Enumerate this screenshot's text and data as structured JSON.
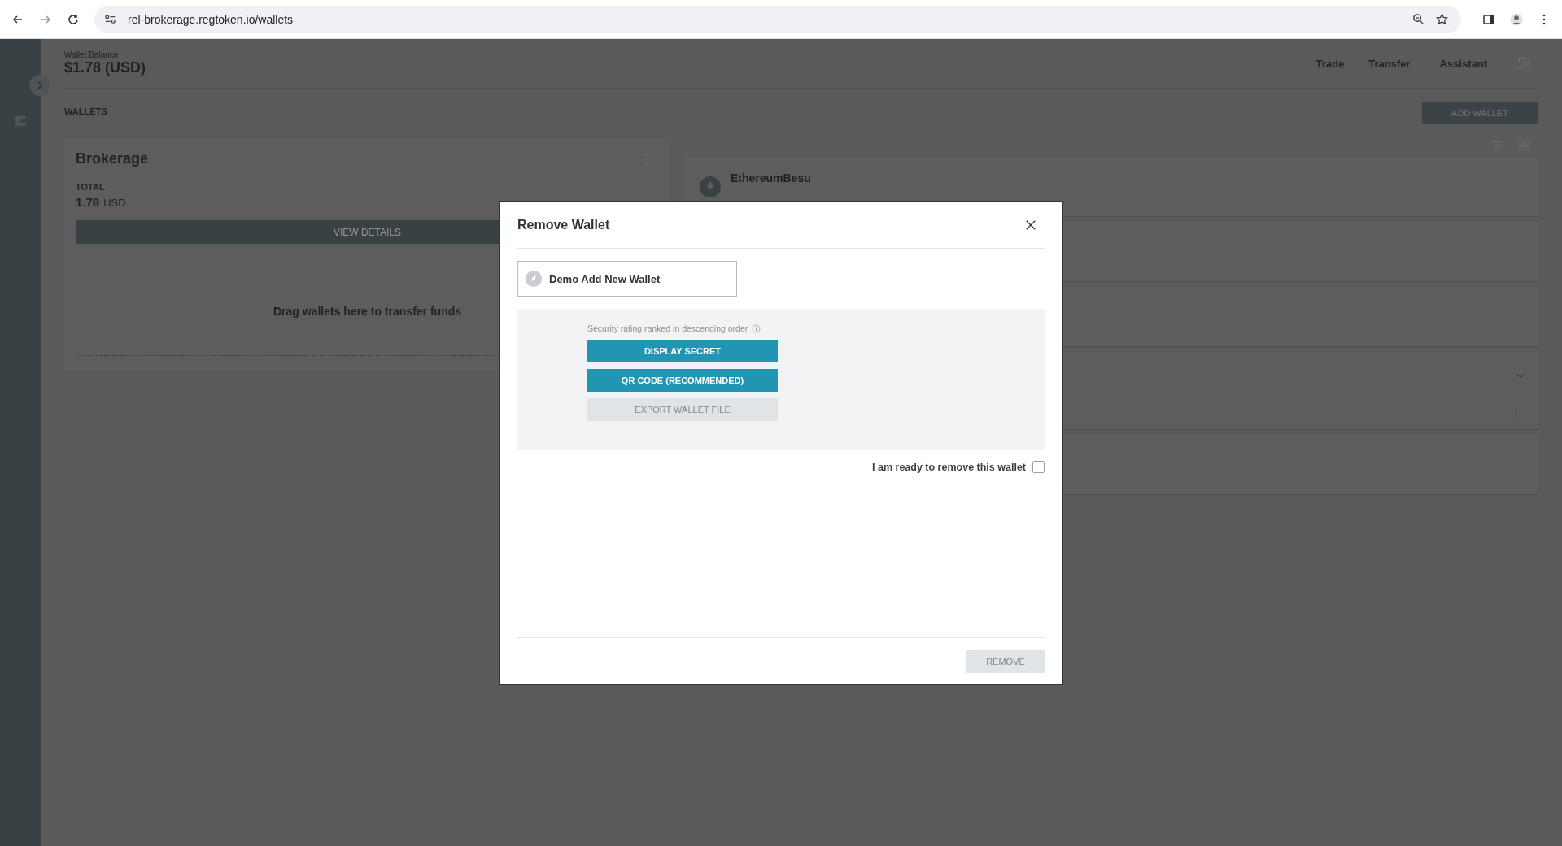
{
  "browser": {
    "url": "rel-brokerage.regtoken.io/wallets"
  },
  "header": {
    "balance_label": "Wallet Balance",
    "balance": "$1.78 (USD)",
    "nav": [
      "Trade",
      "Transfer",
      "Assistant"
    ]
  },
  "wallets": {
    "title": "WALLETS",
    "add_button": "ADD WALLET"
  },
  "card": {
    "name": "Brokerage",
    "total_label": "TOTAL",
    "amount": "1.78",
    "currency": "USD",
    "details_button": "VIEW DETAILS",
    "drop_hint": "Drag wallets here to transfer funds"
  },
  "list": {
    "items": [
      {
        "name": "EthereumBesu"
      }
    ]
  },
  "modal": {
    "title": "Remove Wallet",
    "wallet": "Demo Add New Wallet",
    "hint": "Security rating ranked in descending order",
    "options": [
      {
        "label": "DISPLAY SECRET",
        "disabled": false
      },
      {
        "label": "QR CODE (RECOMMENDED)",
        "disabled": false
      },
      {
        "label": "EXPORT WALLET FILE",
        "disabled": true
      }
    ],
    "confirm": {
      "label": "I am ready to remove this wallet",
      "checked": false
    },
    "remove": {
      "label": "REMOVE",
      "disabled": true
    }
  }
}
